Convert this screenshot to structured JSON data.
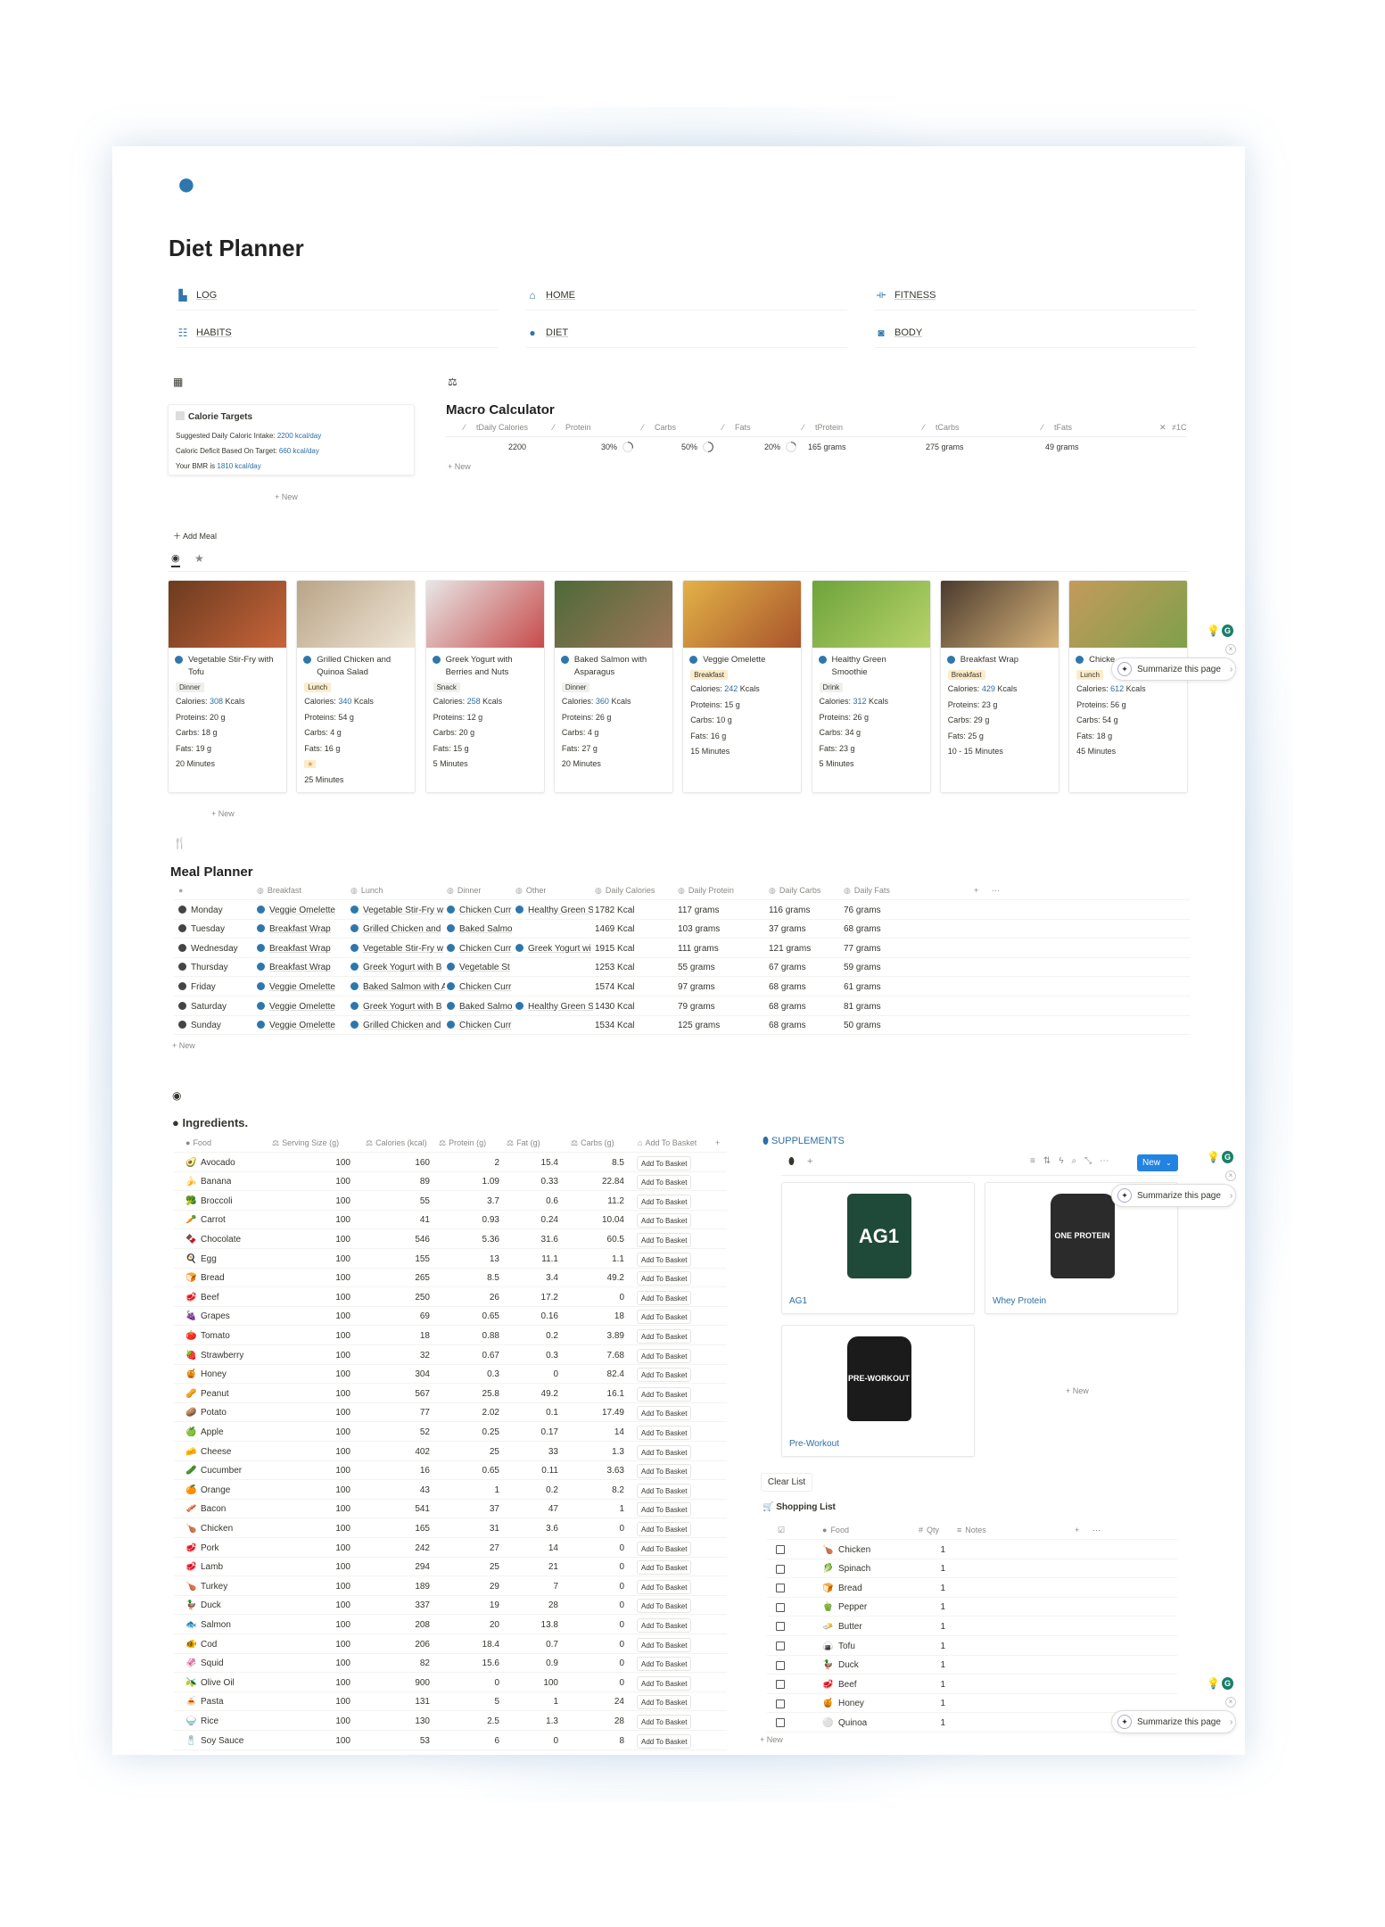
{
  "page": {
    "title": "Diet Planner",
    "icon": "apple-icon",
    "accent": "#2e77ad"
  },
  "nav": [
    {
      "label": "LOG",
      "icon": "document-icon",
      "glyph": "▙"
    },
    {
      "label": "HOME",
      "icon": "home-icon",
      "glyph": "⌂"
    },
    {
      "label": "FITNESS",
      "icon": "dumbbell-icon",
      "glyph": "⟛"
    },
    {
      "label": "HABITS",
      "icon": "checklist-icon",
      "glyph": "☷"
    },
    {
      "label": "DIET",
      "icon": "apple-icon",
      "glyph": "●"
    },
    {
      "label": "BODY",
      "icon": "camera-icon",
      "glyph": "◙"
    }
  ],
  "calorie": {
    "heading": "Calorie Targets",
    "lines": [
      {
        "label": "Suggested Daily Caloric Intake: ",
        "value": "2200 kcal/day"
      },
      {
        "label": "Caloric Deficit Based On Target: ",
        "value": "660 kcal/day"
      },
      {
        "label": "Your BMR is ",
        "value": "1810 kcal/day"
      }
    ],
    "new": "+ New"
  },
  "macro": {
    "title": "Macro Calculator",
    "headers": [
      "tDaily Calories",
      "Protein",
      "Carbs",
      "Fats",
      "tProtein",
      "tCarbs",
      "tFats",
      "≠1C"
    ],
    "values": [
      "2200",
      "30%",
      "50%",
      "20%",
      "165 grams",
      "275 grams",
      "49 grams"
    ],
    "progress": [
      30,
      50,
      20
    ],
    "new": "+ New"
  },
  "meals": {
    "add_label": "Add Meal",
    "new": "+ New",
    "cards": [
      {
        "name": "Vegetable Stir-Fry with Tofu",
        "tag": "Dinner",
        "cal": "308",
        "protein": "Proteins: 20 g",
        "carbs": "Carbs: 18 g",
        "fats": "Fats: 19 g",
        "time": "20 Minutes"
      },
      {
        "name": "Grilled Chicken and Quinoa Salad",
        "tag": "Lunch",
        "cal": "340",
        "protein": "Proteins: 54 g",
        "carbs": "Carbs: 4 g",
        "fats": "Fats: 16 g",
        "star": "★",
        "time": "25 Minutes"
      },
      {
        "name": "Greek Yogurt with Berries and Nuts",
        "tag": "Snack",
        "cal": "258",
        "protein": "Proteins: 12 g",
        "carbs": "Carbs: 20 g",
        "fats": "Fats: 15 g",
        "time": "5 Minutes"
      },
      {
        "name": "Baked Salmon with Asparagus",
        "tag": "Dinner",
        "cal": "360",
        "protein": "Proteins: 26 g",
        "carbs": "Carbs: 4 g",
        "fats": "Fats: 27 g",
        "time": "20 Minutes"
      },
      {
        "name": "Veggie Omelette",
        "tag": "Breakfast",
        "cal": "242",
        "protein": "Proteins: 15 g",
        "carbs": "Carbs: 10 g",
        "fats": "Fats: 16 g",
        "time": "15 Minutes"
      },
      {
        "name": "Healthy Green Smoothie",
        "tag": "Drink",
        "cal": "312",
        "protein": "Proteins: 26 g",
        "carbs": "Carbs: 34 g",
        "fats": "Fats: 23 g",
        "time": "5 Minutes"
      },
      {
        "name": "Breakfast Wrap",
        "tag": "Breakfast",
        "cal": "429",
        "protein": "Proteins: 23 g",
        "carbs": "Carbs: 29 g",
        "fats": "Fats: 25 g",
        "time": "10 - 15 Minutes"
      },
      {
        "name": "Chicke…",
        "tag": "Lunch",
        "cal": "612",
        "protein": "Proteins: 56 g",
        "carbs": "Carbs: 54 g",
        "fats": "Fats: 18 g",
        "time": "45 Minutes"
      }
    ],
    "cal_prefix": "Calories: ",
    "cal_suffix": " Kcals"
  },
  "planner": {
    "title": "Meal Planner",
    "headers": [
      "",
      "Breakfast",
      "Lunch",
      "Dinner",
      "Other",
      "Daily Calories",
      "Daily Protein",
      "Daily Carbs",
      "Daily Fats"
    ],
    "new": "+ New",
    "rows": [
      [
        "Monday",
        "Veggie Omelette",
        "Vegetable Stir-Fry w",
        "Chicken Curr",
        "Healthy Green S",
        "1782 Kcal",
        "117 grams",
        "116 grams",
        "76 grams"
      ],
      [
        "Tuesday",
        "Breakfast Wrap",
        "Grilled Chicken and",
        "Baked Salmo",
        "",
        "1469 Kcal",
        "103 grams",
        "37 grams",
        "68 grams"
      ],
      [
        "Wednesday",
        "Breakfast Wrap",
        "Vegetable Stir-Fry w",
        "Chicken Curr",
        "Greek Yogurt wi",
        "1915 Kcal",
        "111 grams",
        "121 grams",
        "77 grams"
      ],
      [
        "Thursday",
        "Breakfast Wrap",
        "Greek Yogurt with B",
        "Vegetable St",
        "",
        "1253 Kcal",
        "55 grams",
        "67 grams",
        "59 grams"
      ],
      [
        "Friday",
        "Veggie Omelette",
        "Baked Salmon with A",
        "Chicken Curr",
        "",
        "1574 Kcal",
        "97 grams",
        "68 grams",
        "61 grams"
      ],
      [
        "Saturday",
        "Veggie Omelette",
        "Greek Yogurt with B",
        "Baked Salmo",
        "Healthy Green S",
        "1430 Kcal",
        "79 grams",
        "68 grams",
        "81 grams"
      ],
      [
        "Sunday",
        "Veggie Omelette",
        "Grilled Chicken and",
        "Chicken Curr",
        "",
        "1534 Kcal",
        "125 grams",
        "68 grams",
        "50 grams"
      ]
    ]
  },
  "ingredients": {
    "title": "Ingredients.",
    "headers": [
      "Food",
      "Serving Size (g)",
      "Calories (kcal)",
      "Protein (g)",
      "Fat (g)",
      "Carbs (g)",
      "Add To Basket"
    ],
    "button": "Add To Basket",
    "rows": [
      [
        "🥑",
        "Avocado",
        "100",
        "160",
        "2",
        "15.4",
        "8.5"
      ],
      [
        "🍌",
        "Banana",
        "100",
        "89",
        "1.09",
        "0.33",
        "22.84"
      ],
      [
        "🥦",
        "Broccoli",
        "100",
        "55",
        "3.7",
        "0.6",
        "11.2"
      ],
      [
        "🥕",
        "Carrot",
        "100",
        "41",
        "0.93",
        "0.24",
        "10.04"
      ],
      [
        "🍫",
        "Chocolate",
        "100",
        "546",
        "5.36",
        "31.6",
        "60.5"
      ],
      [
        "🍳",
        "Egg",
        "100",
        "155",
        "13",
        "11.1",
        "1.1"
      ],
      [
        "🍞",
        "Bread",
        "100",
        "265",
        "8.5",
        "3.4",
        "49.2"
      ],
      [
        "🥩",
        "Beef",
        "100",
        "250",
        "26",
        "17.2",
        "0"
      ],
      [
        "🍇",
        "Grapes",
        "100",
        "69",
        "0.65",
        "0.16",
        "18"
      ],
      [
        "🍅",
        "Tomato",
        "100",
        "18",
        "0.88",
        "0.2",
        "3.89"
      ],
      [
        "🍓",
        "Strawberry",
        "100",
        "32",
        "0.67",
        "0.3",
        "7.68"
      ],
      [
        "🍯",
        "Honey",
        "100",
        "304",
        "0.3",
        "0",
        "82.4"
      ],
      [
        "🥜",
        "Peanut",
        "100",
        "567",
        "25.8",
        "49.2",
        "16.1"
      ],
      [
        "🥔",
        "Potato",
        "100",
        "77",
        "2.02",
        "0.1",
        "17.49"
      ],
      [
        "🍏",
        "Apple",
        "100",
        "52",
        "0.25",
        "0.17",
        "14"
      ],
      [
        "🧀",
        "Cheese",
        "100",
        "402",
        "25",
        "33",
        "1.3"
      ],
      [
        "🥒",
        "Cucumber",
        "100",
        "16",
        "0.65",
        "0.11",
        "3.63"
      ],
      [
        "🍊",
        "Orange",
        "100",
        "43",
        "1",
        "0.2",
        "8.2"
      ],
      [
        "🥓",
        "Bacon",
        "100",
        "541",
        "37",
        "47",
        "1"
      ],
      [
        "🍗",
        "Chicken",
        "100",
        "165",
        "31",
        "3.6",
        "0"
      ],
      [
        "🥩",
        "Pork",
        "100",
        "242",
        "27",
        "14",
        "0"
      ],
      [
        "🥩",
        "Lamb",
        "100",
        "294",
        "25",
        "21",
        "0"
      ],
      [
        "🍗",
        "Turkey",
        "100",
        "189",
        "29",
        "7",
        "0"
      ],
      [
        "🦆",
        "Duck",
        "100",
        "337",
        "19",
        "28",
        "0"
      ],
      [
        "🐟",
        "Salmon",
        "100",
        "208",
        "20",
        "13.8",
        "0"
      ],
      [
        "🐠",
        "Cod",
        "100",
        "206",
        "18.4",
        "0.7",
        "0"
      ],
      [
        "🦑",
        "Squid",
        "100",
        "82",
        "15.6",
        "0.9",
        "0"
      ],
      [
        "🫒",
        "Olive Oil",
        "100",
        "900",
        "0",
        "100",
        "0"
      ],
      [
        "🍝",
        "Pasta",
        "100",
        "131",
        "5",
        "1",
        "24"
      ],
      [
        "🍚",
        "Rice",
        "100",
        "130",
        "2.5",
        "1.3",
        "28"
      ],
      [
        "🧂",
        "Soy Sauce",
        "100",
        "53",
        "6",
        "0",
        "8"
      ]
    ]
  },
  "supplements": {
    "title": "SUPPLEMENTS",
    "new_button": "New",
    "new": "+ New",
    "items": [
      {
        "name": "AG1",
        "label": "AG1"
      },
      {
        "name": "Whey Protein",
        "label": "ONE PROTEIN"
      },
      {
        "name": "Pre-Workout",
        "label": "PRE-WORKOUT"
      }
    ]
  },
  "shopping": {
    "clear": "Clear List",
    "title": "Shopping List",
    "headers": [
      "Food",
      "Qty",
      "Notes"
    ],
    "new": "+ New",
    "rows": [
      [
        "🍗",
        "Chicken",
        "1"
      ],
      [
        "🥬",
        "Spinach",
        "1"
      ],
      [
        "🍞",
        "Bread",
        "1"
      ],
      [
        "🫑",
        "Pepper",
        "1"
      ],
      [
        "🧈",
        "Butter",
        "1"
      ],
      [
        "🍙",
        "Tofu",
        "1"
      ],
      [
        "🦆",
        "Duck",
        "1"
      ],
      [
        "🥩",
        "Beef",
        "1"
      ],
      [
        "🍯",
        "Honey",
        "1"
      ],
      [
        "⚪",
        "Quinoa",
        "1"
      ]
    ]
  },
  "assistant": {
    "summarize": "Summarize this page"
  }
}
